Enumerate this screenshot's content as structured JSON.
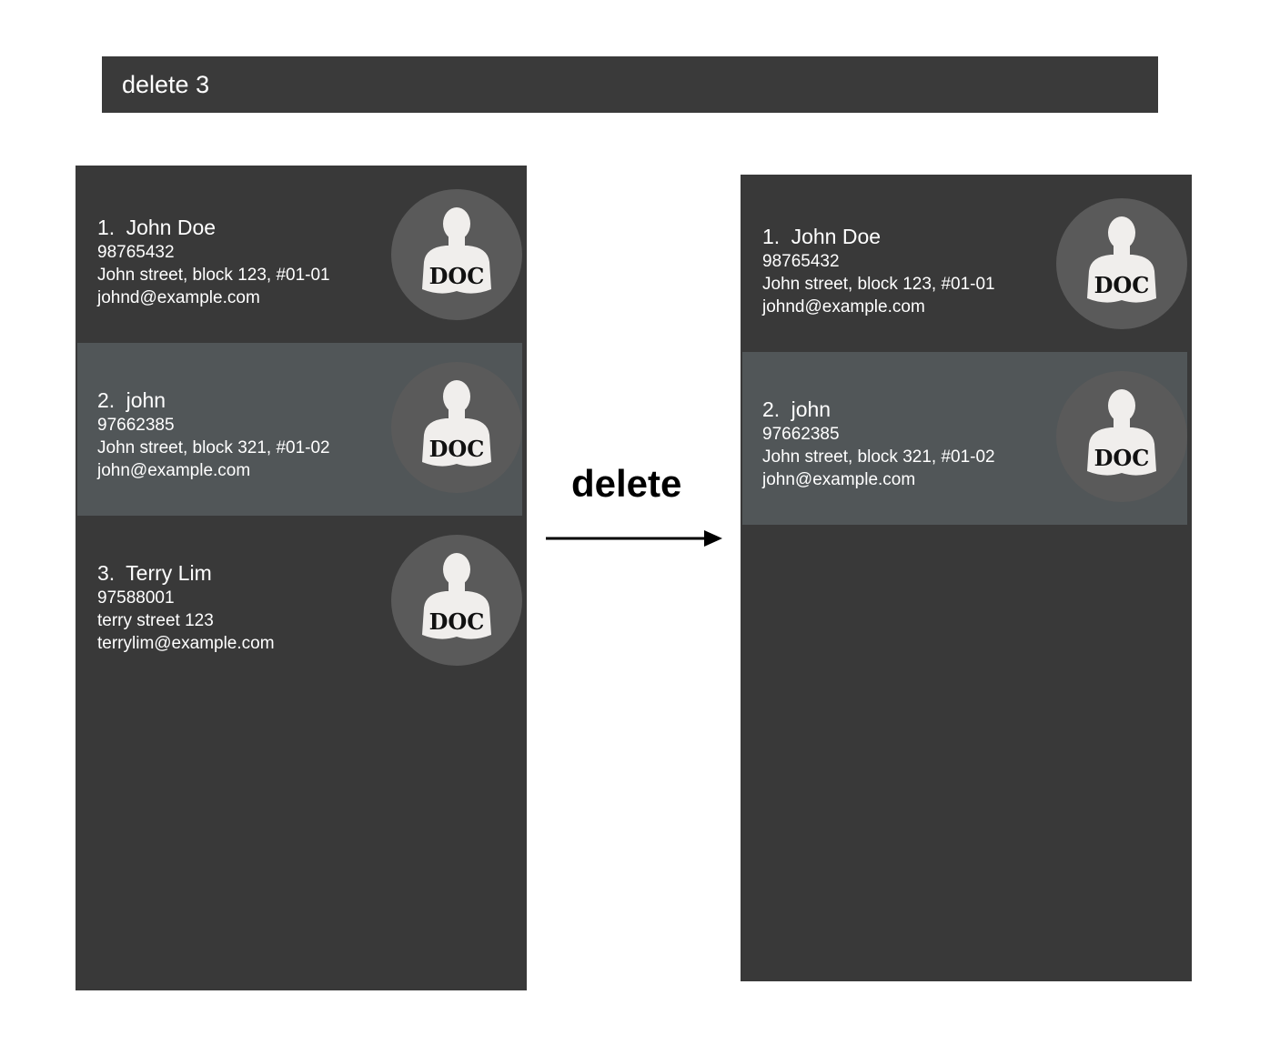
{
  "command": {
    "text": "delete 3"
  },
  "transition": {
    "label": "delete"
  },
  "avatar_label": "DOC",
  "colors": {
    "panel": "#393939",
    "card_alt": "#515658",
    "avatar_bg": "#5a5a5a",
    "avatar_figure": "#f0eeec"
  },
  "before": {
    "persons": [
      {
        "index": "1.",
        "name": "John Doe",
        "phone": "98765432",
        "address": "John street, block 123, #01-01",
        "email": "johnd@example.com"
      },
      {
        "index": "2.",
        "name": "john",
        "phone": "97662385",
        "address": "John street, block 321, #01-02",
        "email": "john@example.com"
      },
      {
        "index": "3.",
        "name": "Terry Lim",
        "phone": "97588001",
        "address": "terry street 123",
        "email": "terrylim@example.com"
      }
    ]
  },
  "after": {
    "persons": [
      {
        "index": "1.",
        "name": "John Doe",
        "phone": "98765432",
        "address": "John street, block 123, #01-01",
        "email": "johnd@example.com"
      },
      {
        "index": "2.",
        "name": "john",
        "phone": "97662385",
        "address": "John street, block 321, #01-02",
        "email": "john@example.com"
      }
    ]
  }
}
